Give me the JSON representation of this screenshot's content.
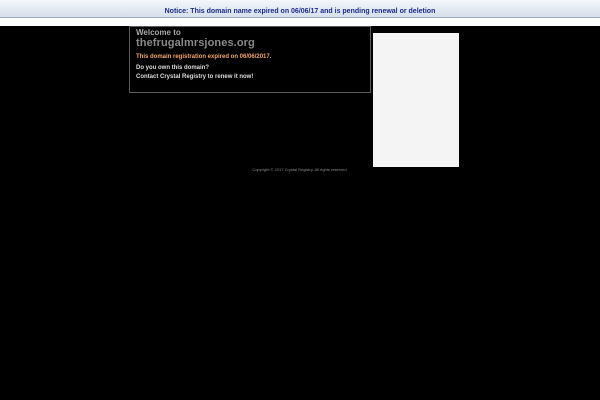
{
  "notice": {
    "text": "Notice: This domain name expired on 06/06/17 and is pending renewal or deletion"
  },
  "welcome": {
    "label": "Welcome to",
    "domain": "thefrugalmrsjones.org",
    "expired_text": "This domain registration expired on 06/06/2017.",
    "own_question": "Do you own this domain?",
    "renew_text": "Contact Crystal Registry to renew it now!"
  },
  "footer": {
    "copyright": "Copyright © 2017 Crystal Registry. All rights reserved."
  },
  "colors": {
    "background": "#000000",
    "notice_text": "#1a2a8a",
    "expired_text": "#f2a76a",
    "ad_panel": "#f4f4f4"
  }
}
